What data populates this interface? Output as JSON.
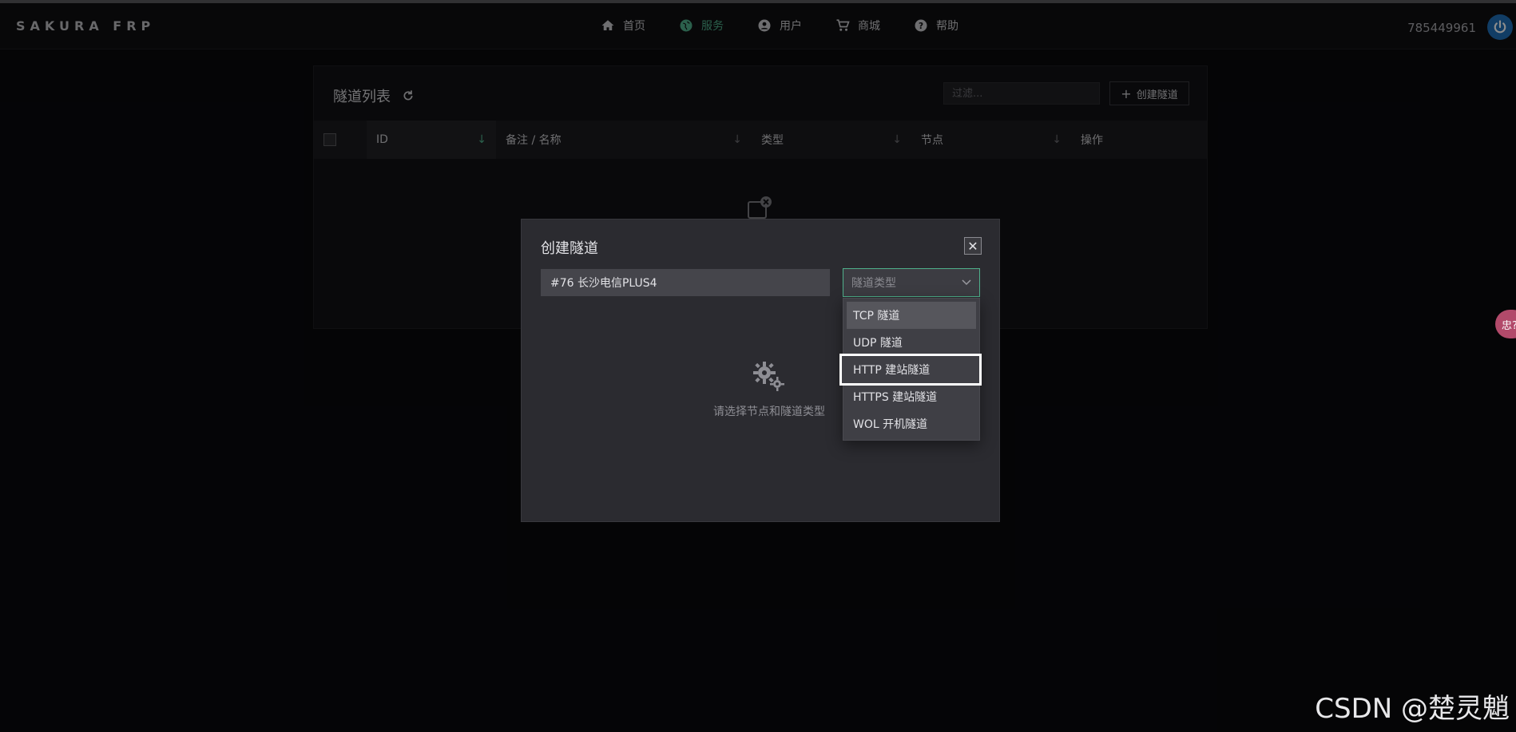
{
  "app": {
    "logo": "SAKURA FRP",
    "user_id": "785449961"
  },
  "nav": [
    {
      "label": "首页",
      "icon": "home-icon",
      "active": false
    },
    {
      "label": "服务",
      "icon": "globe-icon",
      "active": true
    },
    {
      "label": "用户",
      "icon": "user-icon",
      "active": false
    },
    {
      "label": "商城",
      "icon": "cart-icon",
      "active": false
    },
    {
      "label": "帮助",
      "icon": "help-icon",
      "active": false
    }
  ],
  "panel": {
    "title": "隧道列表",
    "filter_placeholder": "过滤...",
    "create_label": "创建隧道",
    "columns": [
      "ID",
      "备注 / 名称",
      "类型",
      "节点",
      "操作"
    ]
  },
  "modal": {
    "title": "创建隧道",
    "close_label": "✕",
    "node_value": "#76 长沙电信PLUS4",
    "type_placeholder": "隧道类型",
    "empty_text": "请选择节点和隧道类型"
  },
  "dropdown": {
    "options": [
      "TCP 隧道",
      "UDP 隧道",
      "HTTP 建站隧道",
      "HTTPS 建站隧道",
      "WOL 开机隧道"
    ],
    "hovered_index": 0,
    "focused_index": 2
  },
  "side_tab": {
    "label": "忠?"
  },
  "watermark": "CSDN @楚灵魈",
  "colors": {
    "accent": "#4fb08b",
    "power": "#1f6fb8",
    "side_tab": "#b24a6a"
  }
}
